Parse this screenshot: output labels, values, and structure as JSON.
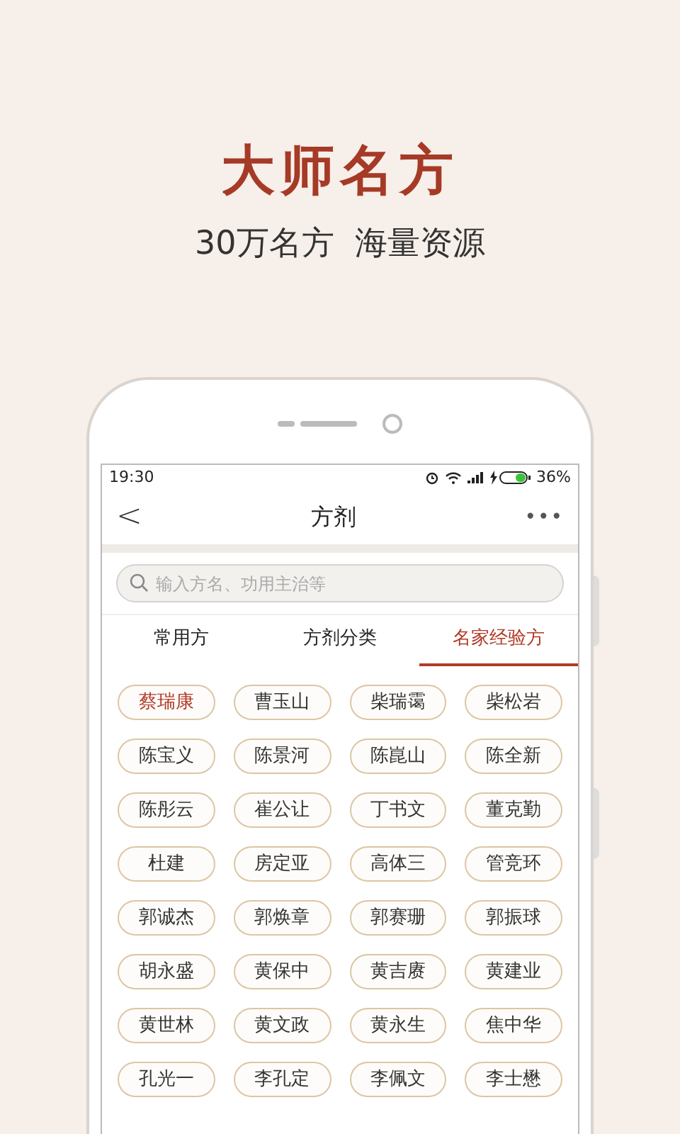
{
  "headline": "大师名方",
  "tagline": "30万名方  海量资源",
  "status_bar": {
    "time": "19:30",
    "battery": "36%"
  },
  "nav": {
    "back": "<",
    "title": "方剂",
    "more": "•••"
  },
  "search": {
    "placeholder": "输入方名、功用主治等"
  },
  "tabs": [
    {
      "label": "常用方",
      "selected": false
    },
    {
      "label": "方剂分类",
      "selected": false
    },
    {
      "label": "名家经验方",
      "selected": true
    }
  ],
  "experts": [
    {
      "name": "蔡瑞康",
      "selected": true
    },
    {
      "name": "曹玉山",
      "selected": false
    },
    {
      "name": "柴瑞霭",
      "selected": false
    },
    {
      "name": "柴松岩",
      "selected": false
    },
    {
      "name": "陈宝义",
      "selected": false
    },
    {
      "name": "陈景河",
      "selected": false
    },
    {
      "name": "陈崑山",
      "selected": false
    },
    {
      "name": "陈全新",
      "selected": false
    },
    {
      "name": "陈彤云",
      "selected": false
    },
    {
      "name": "崔公让",
      "selected": false
    },
    {
      "name": "丁书文",
      "selected": false
    },
    {
      "name": "董克勤",
      "selected": false
    },
    {
      "name": "杜建",
      "selected": false
    },
    {
      "name": "房定亚",
      "selected": false
    },
    {
      "name": "高体三",
      "selected": false
    },
    {
      "name": "管竞环",
      "selected": false
    },
    {
      "name": "郭诚杰",
      "selected": false
    },
    {
      "name": "郭焕章",
      "selected": false
    },
    {
      "name": "郭赛珊",
      "selected": false
    },
    {
      "name": "郭振球",
      "selected": false
    },
    {
      "name": "胡永盛",
      "selected": false
    },
    {
      "name": "黄保中",
      "selected": false
    },
    {
      "name": "黄吉赓",
      "selected": false
    },
    {
      "name": "黄建业",
      "selected": false
    },
    {
      "name": "黄世林",
      "selected": false
    },
    {
      "name": "黄文政",
      "selected": false
    },
    {
      "name": "黄永生",
      "selected": false
    },
    {
      "name": "焦中华",
      "selected": false
    },
    {
      "name": "孔光一",
      "selected": false
    },
    {
      "name": "李孔定",
      "selected": false
    },
    {
      "name": "李佩文",
      "selected": false
    },
    {
      "name": "李士懋",
      "selected": false
    }
  ]
}
